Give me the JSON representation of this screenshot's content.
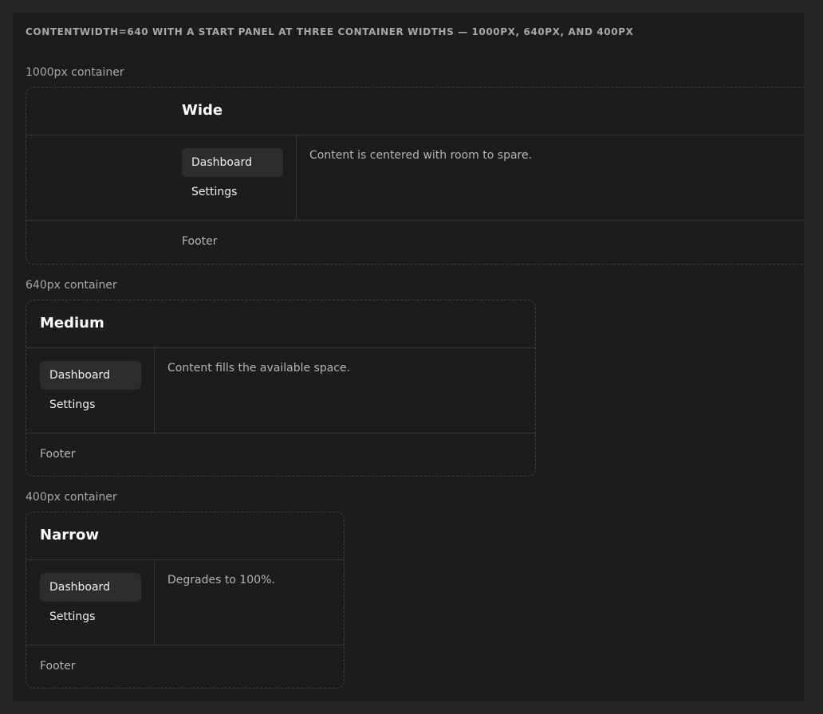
{
  "page": {
    "title": "contentWidth=640 with a start panel at three container widths — 1000px, 640px, and 400px"
  },
  "demos": [
    {
      "container_label": "1000px container",
      "title": "Wide",
      "nav": [
        {
          "label": "Dashboard",
          "active": true
        },
        {
          "label": "Settings",
          "active": false
        }
      ],
      "content": "Content is centered with room to spare.",
      "footer": "Footer"
    },
    {
      "container_label": "640px container",
      "title": "Medium",
      "nav": [
        {
          "label": "Dashboard",
          "active": true
        },
        {
          "label": "Settings",
          "active": false
        }
      ],
      "content": "Content fills the available space.",
      "footer": "Footer"
    },
    {
      "container_label": "400px container",
      "title": "Narrow",
      "nav": [
        {
          "label": "Dashboard",
          "active": true
        },
        {
          "label": "Settings",
          "active": false
        }
      ],
      "content": "Degrades to 100%.",
      "footer": "Footer"
    }
  ],
  "colors": {
    "outer_background": "#262626",
    "frame_background": "#1c1c1c",
    "dashed_border": "#3f3f3f",
    "divider": "#363636",
    "active_nav_background": "#2c2c2c",
    "muted_text": "#a8a8a8",
    "title_text": "#ffffff"
  }
}
